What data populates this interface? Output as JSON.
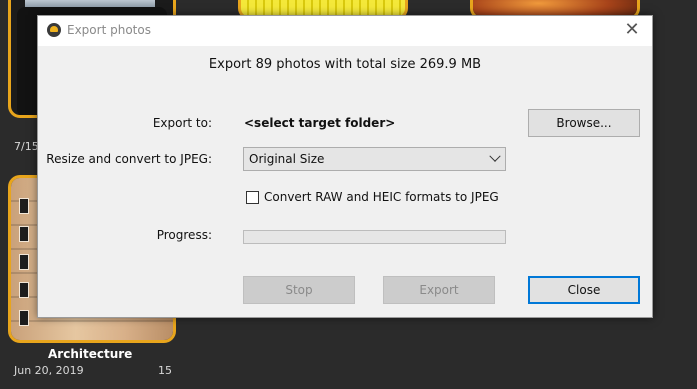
{
  "background": {
    "partial_date": "7/15",
    "album": {
      "title": "Architecture",
      "date": "Jun 20, 2019",
      "count": "15"
    }
  },
  "dialog": {
    "title": "Export photos",
    "close_glyph": "✕",
    "summary": "Export 89 photos with total size 269.9 MB",
    "export_to_label": "Export to:",
    "target_folder": "<select target folder>",
    "browse_label": "Browse...",
    "resize_label": "Resize and convert to JPEG:",
    "resize_selected": "Original Size",
    "convert_checkbox_label": "Convert RAW and HEIC formats to JPEG",
    "convert_checked": false,
    "progress_label": "Progress:",
    "progress_value": 0,
    "stop_label": "Stop",
    "export_label": "Export",
    "close_label": "Close"
  },
  "colors": {
    "album_border": "#e8a51c",
    "focus_border": "#0078d7",
    "progress_fill": "#06b025"
  }
}
